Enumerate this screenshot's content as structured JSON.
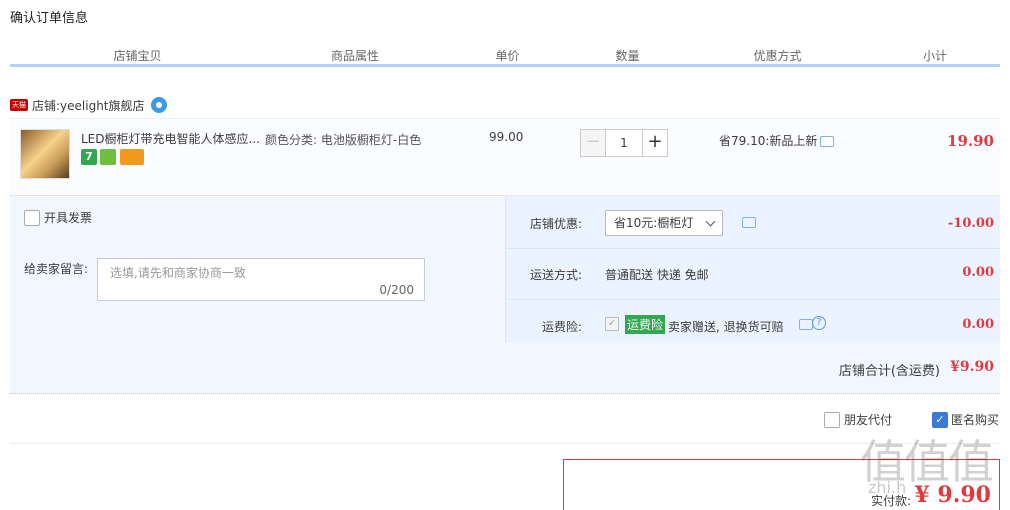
{
  "section_title": "确认订单信息",
  "columns": [
    "店铺宝贝",
    "商品属性",
    "单价",
    "数量",
    "优惠方式",
    "小计"
  ],
  "shop": {
    "badge": "天猫",
    "label": "店铺:",
    "name": "yeelight旗舰店"
  },
  "item": {
    "title": "LED橱柜灯带充电智能人体感应...",
    "service_badge": "7",
    "attribute": "颜色分类: 电池版橱柜灯-白色",
    "price": "99.00",
    "quantity": "1",
    "minus_label": "−",
    "plus_label": "+",
    "promo": "省79.10:新品上新",
    "subtotal": "19.90"
  },
  "invoice": {
    "label": "开具发票"
  },
  "message": {
    "label": "给卖家留言:",
    "placeholder": "选填,请先和商家协商一致",
    "count": "0/200"
  },
  "shop_discount": {
    "label": "店铺优惠:",
    "selected": "省10元:橱柜灯",
    "amount": "-10.00"
  },
  "shipping": {
    "label": "运送方式:",
    "value": "普通配送 快递 免邮",
    "amount": "0.00"
  },
  "insurance": {
    "label": "运费险:",
    "tag": "运费险",
    "text": "卖家赠送, 退换货可赔",
    "help": "?",
    "amount": "0.00"
  },
  "shop_total": {
    "label": "店铺合计(含运费)",
    "amount": "¥9.90"
  },
  "options": {
    "friend_pay": "朋友代付",
    "anonymous": "匿名购买"
  },
  "payment": {
    "label": "实付款:",
    "amount": "¥ 9.90"
  },
  "watermark": {
    "main": "值值值",
    "sub": "zhi.h"
  },
  "colors": {
    "accent_red": "#e4393c",
    "header_line": "#b2d1ff",
    "panel_bg": "#f2f7ff",
    "insurance_green": "#2fa84f",
    "checkbox_blue": "#3b7ad9"
  }
}
